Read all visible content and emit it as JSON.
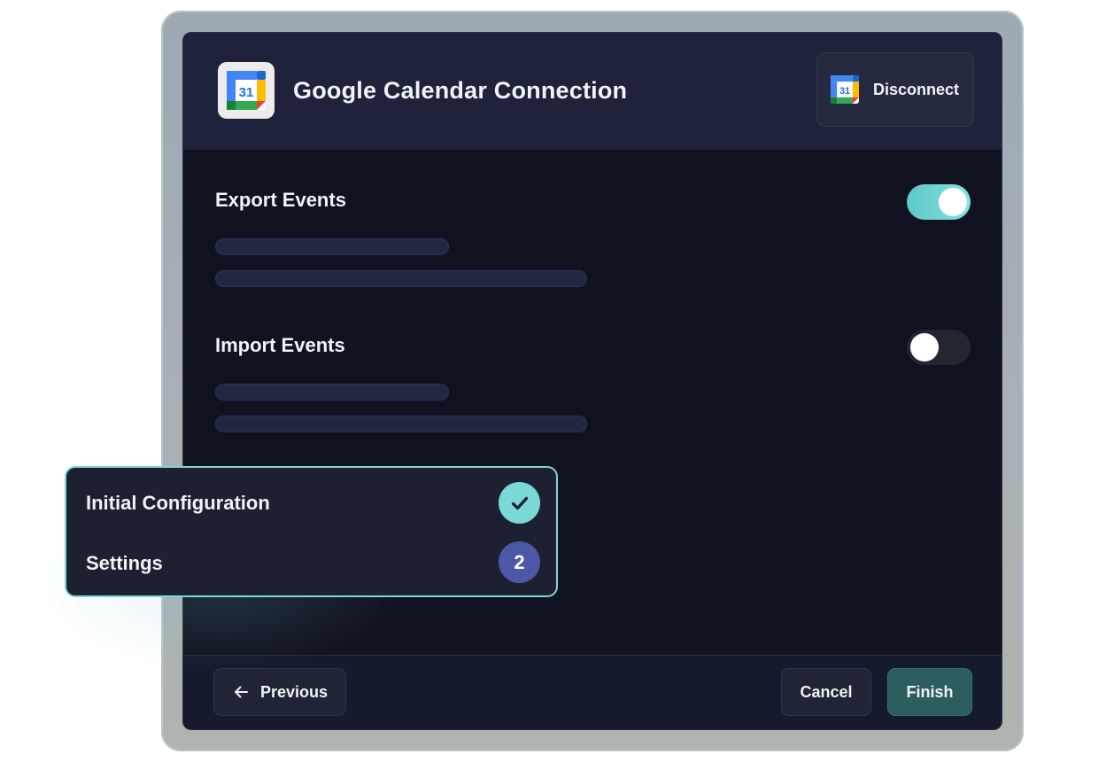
{
  "header": {
    "title": "Google Calendar Connection",
    "app_icon": "google-calendar-icon",
    "calendar_day": "31",
    "disconnect_label": "Disconnect"
  },
  "sections": [
    {
      "title": "Export Events",
      "enabled": true
    },
    {
      "title": "Import Events",
      "enabled": false
    }
  ],
  "footer": {
    "previous_label": "Previous",
    "cancel_label": "Cancel",
    "finish_label": "Finish"
  },
  "steps": [
    {
      "label": "Initial Configuration",
      "status": "complete",
      "icon": "check-icon"
    },
    {
      "label": "Settings",
      "status": "current",
      "number": "2"
    }
  ],
  "colors": {
    "accent": "#7ad8d6",
    "toggle_on": "#6fd3d2",
    "current_step": "#4d57a8",
    "finish_button": "#2b5e5c",
    "window_bg": "#10131f",
    "header_bg": "#1e223b"
  }
}
